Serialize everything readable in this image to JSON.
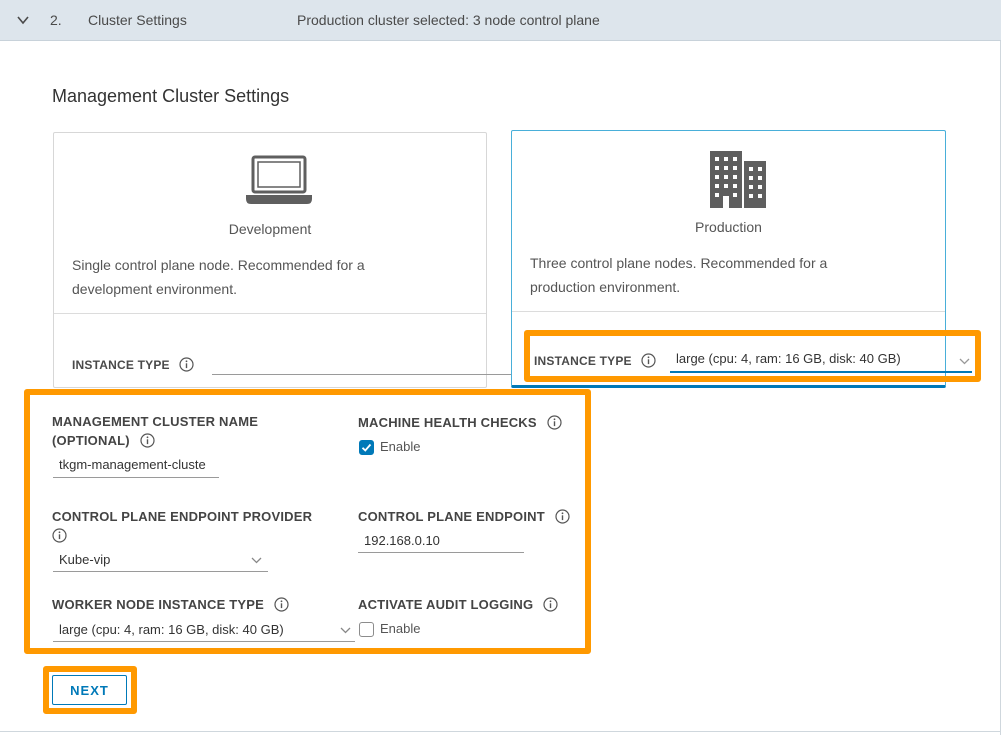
{
  "step": {
    "number": "2.",
    "title": "Cluster Settings",
    "summary": "Production cluster selected: 3 node control plane"
  },
  "section_title": "Management Cluster Settings",
  "plans": [
    {
      "name": "Development",
      "icon": "laptop-icon",
      "description_line1": "Single control plane node. Recommended for a",
      "description_line2": "development environment.",
      "instance_type_label": "INSTANCE TYPE",
      "instance_type_value": "",
      "selected": false
    },
    {
      "name": "Production",
      "icon": "building-icon",
      "description_line1": "Three control plane nodes. Recommended for a",
      "description_line2": "production environment.",
      "instance_type_label": "INSTANCE TYPE",
      "instance_type_value": "large (cpu: 4, ram: 16 GB, disk: 40 GB)",
      "selected": true
    }
  ],
  "form": {
    "cluster_name_label_line1": "MANAGEMENT CLUSTER NAME",
    "cluster_name_label_line2": "(OPTIONAL)",
    "cluster_name_value": "tkgm-management-clustе",
    "health_checks_label": "MACHINE HEALTH CHECKS",
    "health_checks_option": "Enable",
    "health_checks_checked": true,
    "endpoint_provider_label": "CONTROL PLANE ENDPOINT PROVIDER",
    "endpoint_provider_value": "Kube-vip",
    "endpoint_label": "CONTROL PLANE ENDPOINT",
    "endpoint_value": "192.168.0.10",
    "worker_instance_label": "WORKER NODE INSTANCE TYPE",
    "worker_instance_value": "large (cpu: 4, ram: 16 GB, disk: 40 GB)",
    "audit_logging_label": "ACTIVATE AUDIT LOGGING",
    "audit_logging_option": "Enable",
    "audit_logging_checked": false
  },
  "next_button": "NEXT",
  "colors": {
    "accent": "#0079b8",
    "highlight": "#ff9900",
    "header_bg": "#dde5ec"
  }
}
